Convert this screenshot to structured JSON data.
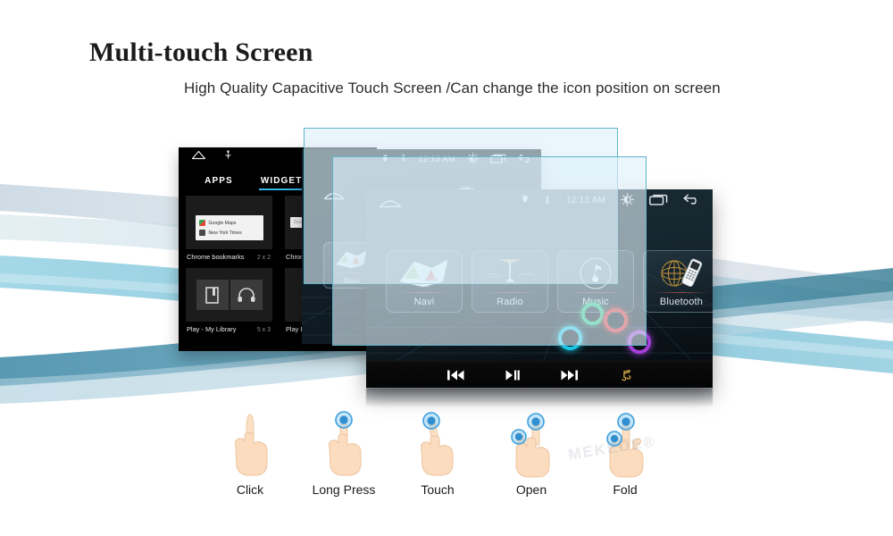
{
  "header": {
    "title": "Multi-touch Screen",
    "subtitle": "High Quality Capacitive Touch Screen /Can change the icon position on screen"
  },
  "colors": {
    "accent_blue": "#33b5e5",
    "glass_border": "#5fb4c8",
    "glass_fill": "#def0fa",
    "screen_dark": "#0c161d",
    "tile_label": "#dce9f2"
  },
  "widgets_screen": {
    "nav_icons": [
      "home-icon",
      "usb-icon"
    ],
    "tabs": [
      {
        "label": "APPS",
        "active": false
      },
      {
        "label": "WIDGETS",
        "active": true
      }
    ],
    "items": [
      {
        "name": "Chrome bookmarks",
        "size": "2 x 2",
        "preview": "chrome-bookmarks-card",
        "rows": [
          "Google Maps",
          "New York Times"
        ]
      },
      {
        "name": "Chrome search",
        "size": "",
        "preview": "search-box",
        "placeholder": "Search"
      },
      {
        "name": "Play - My Library",
        "size": "5 x 3",
        "preview": "book-headphones"
      },
      {
        "name": "Play Recommendations",
        "size": "",
        "preview": "play-store"
      }
    ]
  },
  "car_ui": {
    "status": {
      "location_icon": "location-pin-icon",
      "bluetooth_icon": "bluetooth-icon",
      "time": "12:13 AM",
      "brightness_icon": "brightness-icon",
      "recents_icon": "recents-icon",
      "back_icon": "back-icon"
    },
    "home_icon": "home-icon",
    "play_store_icon": "play-store-icon",
    "tiles": [
      {
        "label": "Navi",
        "icon": "map-compass-icon"
      },
      {
        "label": "Radio",
        "icon": "radio-tower-icon"
      },
      {
        "label": "Music",
        "icon": "music-note-icon"
      },
      {
        "label": "Bluetooth",
        "icon": "bluetooth-phone-icon"
      }
    ],
    "media_controls": [
      {
        "name": "previous-track-button",
        "icon": "skip-previous-icon"
      },
      {
        "name": "play-pause-button",
        "icon": "play-pause-icon"
      },
      {
        "name": "next-track-button",
        "icon": "skip-next-icon"
      },
      {
        "name": "music-library-button",
        "icon": "music-note-icon"
      }
    ],
    "touch_rings": [
      {
        "name": "touch-ring-green",
        "color": "#21c77e"
      },
      {
        "name": "touch-ring-red",
        "color": "#e52b2b"
      },
      {
        "name": "touch-ring-cyan",
        "color": "#19c8e8"
      },
      {
        "name": "touch-ring-purple",
        "color": "#a33fd6"
      }
    ]
  },
  "glass_panels": [
    {
      "name": "glass-panel-back"
    },
    {
      "name": "glass-panel-front"
    }
  ],
  "gestures": [
    {
      "label": "Click",
      "icon": "hand-click-icon",
      "dots": 0
    },
    {
      "label": "Long Press",
      "icon": "hand-long-press-icon",
      "dots": 1
    },
    {
      "label": "Touch",
      "icon": "hand-touch-icon",
      "dots": 1
    },
    {
      "label": "Open",
      "icon": "hand-open-icon",
      "dots": 2
    },
    {
      "label": "Fold",
      "icon": "hand-fold-icon",
      "dots": 2
    }
  ],
  "watermark": "MEKEDE®"
}
